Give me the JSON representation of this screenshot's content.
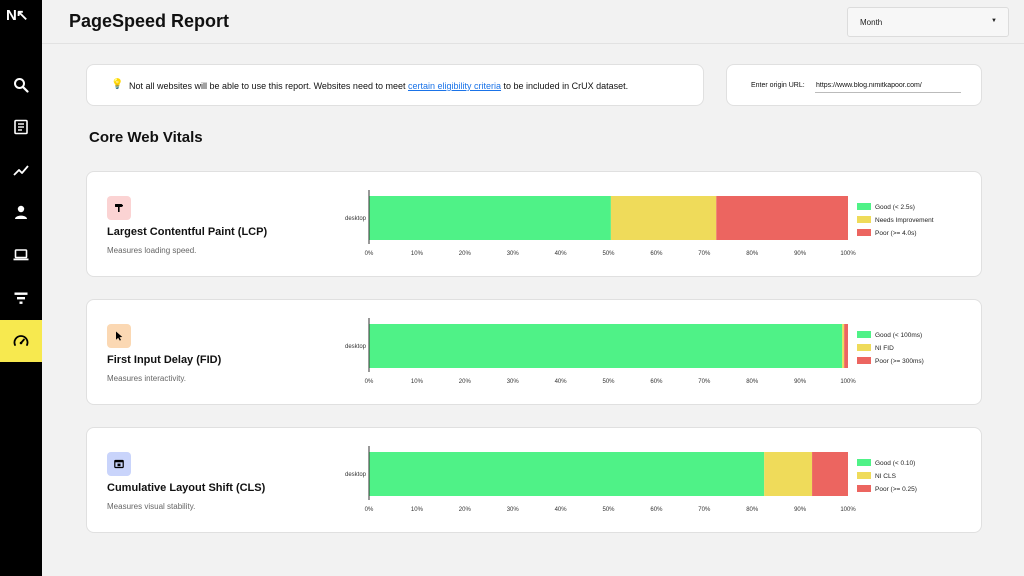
{
  "app": {
    "logo_text": "N↖",
    "title": "PageSpeed Report"
  },
  "sidebar": {
    "items": [
      {
        "icon": "search-icon",
        "active": false
      },
      {
        "icon": "document-icon",
        "active": false
      },
      {
        "icon": "trend-chart-icon",
        "active": false
      },
      {
        "icon": "user-icon",
        "active": false
      },
      {
        "icon": "laptop-icon",
        "active": false
      },
      {
        "icon": "filter-icon",
        "active": false
      },
      {
        "icon": "speedometer-icon",
        "active": true
      }
    ]
  },
  "period": {
    "selected": "Month"
  },
  "notice": {
    "text_before": "Not all websites will be able to use this report. Websites need to meet ",
    "link_text": "certain eligibility criteria",
    "text_after": " to be included in CrUX dataset."
  },
  "origin": {
    "label": "Enter origin URL:",
    "value": "https://www.blog.nimitkapoor.com/"
  },
  "section": {
    "title": "Core Web Vitals"
  },
  "colors": {
    "good": "#4ff287",
    "ni": "#efdb5a",
    "poor": "#ec6560",
    "active_nav": "#f7e94f"
  },
  "metrics": [
    {
      "name": "Largest Contentful Paint (LCP)",
      "description": "Measures loading speed.",
      "icon": "paint-roller-icon",
      "icon_bg": "#fbd3d3"
    },
    {
      "name": "First Input Delay (FID)",
      "description": "Measures interactivity.",
      "icon": "cursor-icon",
      "icon_bg": "#fbd8b3"
    },
    {
      "name": "Cumulative Layout Shift (CLS)",
      "description": "Measures visual stability.",
      "icon": "layout-icon",
      "icon_bg": "#c9d4fb"
    }
  ],
  "chart_data": [
    {
      "type": "bar",
      "orientation": "horizontal-stacked",
      "categories": [
        "desktop"
      ],
      "series": [
        {
          "name": "Good (< 2.5s)",
          "values": [
            50.5
          ]
        },
        {
          "name": "Needs Improvement",
          "values": [
            22
          ]
        },
        {
          "name": "Poor (>= 4.0s)",
          "values": [
            27.5
          ]
        }
      ],
      "xticks": [
        "0%",
        "10%",
        "20%",
        "30%",
        "40%",
        "50%",
        "60%",
        "70%",
        "80%",
        "90%",
        "100%"
      ],
      "xlim": [
        0,
        100
      ],
      "legend": "right"
    },
    {
      "type": "bar",
      "orientation": "horizontal-stacked",
      "categories": [
        "desktop"
      ],
      "series": [
        {
          "name": "Good (< 100ms)",
          "values": [
            98.8
          ]
        },
        {
          "name": "NI FID",
          "values": [
            0.4
          ]
        },
        {
          "name": "Poor (>= 300ms)",
          "values": [
            0.8
          ]
        }
      ],
      "xticks": [
        "0%",
        "10%",
        "20%",
        "30%",
        "40%",
        "50%",
        "60%",
        "70%",
        "80%",
        "90%",
        "100%"
      ],
      "xlim": [
        0,
        100
      ],
      "legend": "right"
    },
    {
      "type": "bar",
      "orientation": "horizontal-stacked",
      "categories": [
        "desktop"
      ],
      "series": [
        {
          "name": "Good (< 0.10)",
          "values": [
            82.5
          ]
        },
        {
          "name": "NI CLS",
          "values": [
            10
          ]
        },
        {
          "name": "Poor (>= 0.25)",
          "values": [
            7.5
          ]
        }
      ],
      "xticks": [
        "0%",
        "10%",
        "20%",
        "30%",
        "40%",
        "50%",
        "60%",
        "70%",
        "80%",
        "90%",
        "100%"
      ],
      "xlim": [
        0,
        100
      ],
      "legend": "right"
    }
  ]
}
